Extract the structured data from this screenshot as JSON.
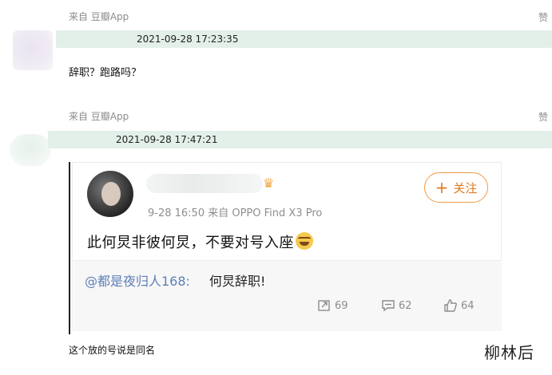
{
  "comment1": {
    "source": "来自 豆瓣App",
    "like": "赞",
    "timestamp": "2021-09-28 17:23:35",
    "text": "辞职？跑路吗？"
  },
  "comment2": {
    "source": "来自 豆瓣App",
    "like": "赞",
    "timestamp": "2021-09-28 17:47:21",
    "text": "这个放的号说是同名"
  },
  "weibo_card": {
    "follow_label": "关注",
    "meta": "9-28 16:50  来自 OPPO Find X3 Pro",
    "post_text": "此何炅非彼何炅，不要对号入座",
    "quote_user": "@都是夜归人168:",
    "quote_text": "何炅辞职!",
    "repost_count": "69",
    "comment_count": "62",
    "like_count": "64"
  },
  "watermark": "柳林后",
  "colors": {
    "strip": "#e3efe9",
    "follow_accent": "#f29b45",
    "mention_blue": "#5d7fb8"
  }
}
